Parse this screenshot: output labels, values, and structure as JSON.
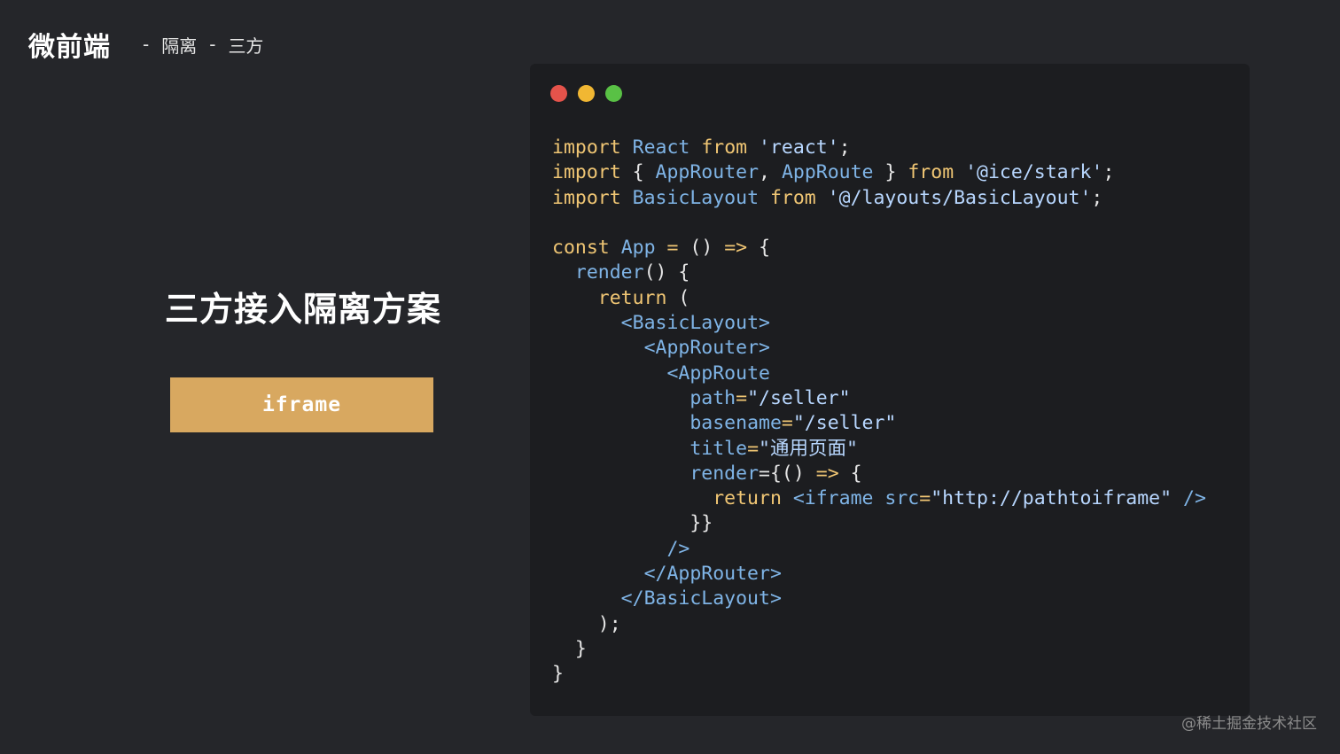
{
  "header": {
    "brand": "微前端",
    "separator": "-",
    "crumbs": [
      "隔离",
      "三方"
    ]
  },
  "hero": {
    "title": "三方接入隔离方案",
    "button_label": "iframe"
  },
  "code_window": {
    "dots": [
      "#e5534b",
      "#f1b733",
      "#59c145"
    ],
    "lines": [
      "import React from 'react';",
      "import { AppRouter, AppRoute } from '@ice/stark';",
      "import BasicLayout from '@/layouts/BasicLayout';",
      "",
      "const App = () => {",
      "  render() {",
      "    return (",
      "      <BasicLayout>",
      "        <AppRouter>",
      "          <AppRoute",
      "            path=\"/seller\"",
      "            basename=\"/seller\"",
      "            title=\"通用页面\"",
      "            render={() => {",
      "              return <iframe src=\"http://pathtoiframe\" />",
      "            }}",
      "          />",
      "        </AppRouter>",
      "      </BasicLayout>",
      "    );",
      "  }",
      "}"
    ]
  },
  "watermark": "@稀土掘金技术社区",
  "colors": {
    "background": "#25262a",
    "code_background": "#1c1d20",
    "button": "#d8a860",
    "keyword": "#f0c674",
    "identifier": "#7fb4e6",
    "string": "#b8d7ff"
  }
}
